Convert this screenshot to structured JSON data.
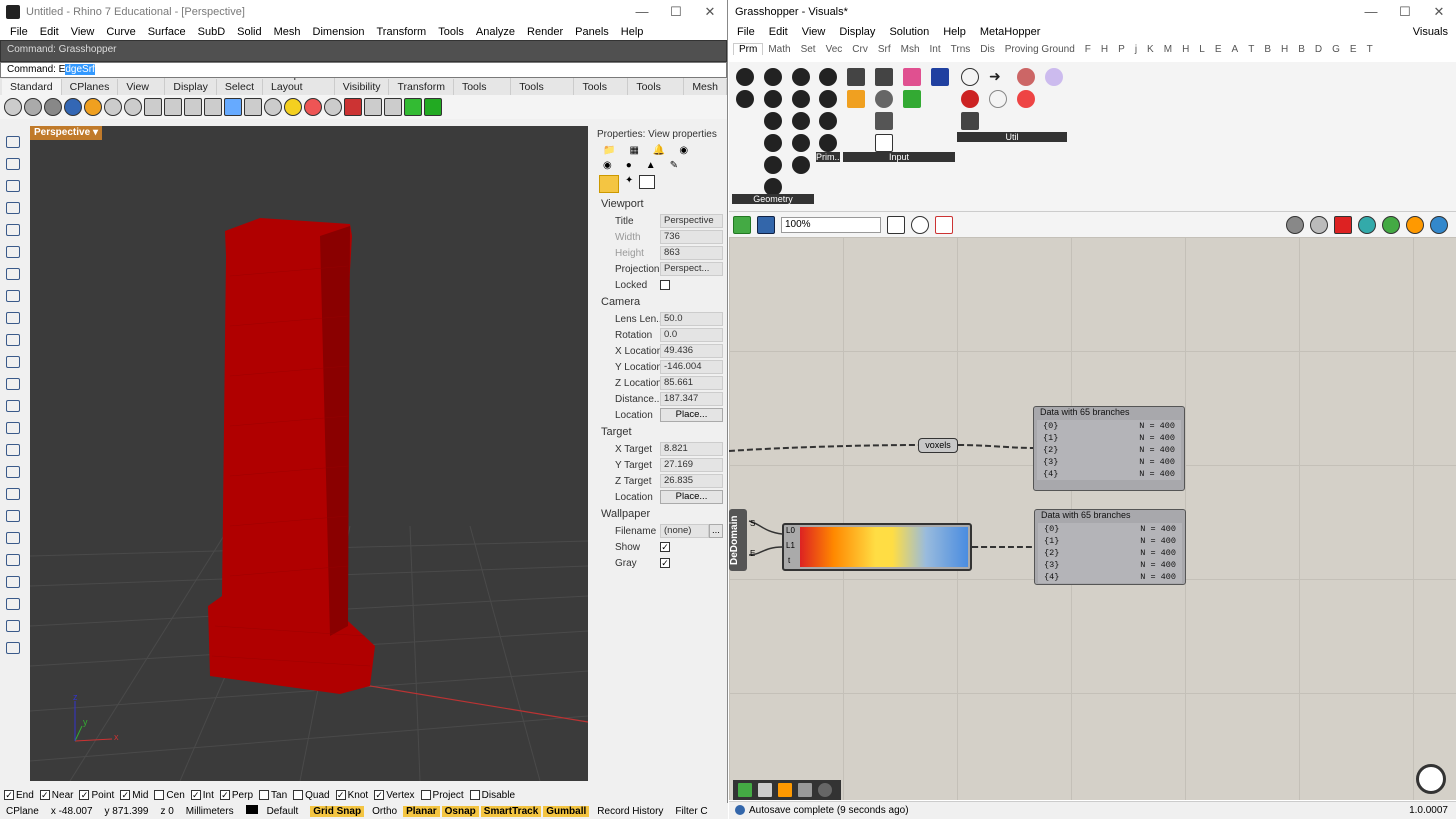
{
  "rhino": {
    "title": "Untitled - Rhino 7 Educational - [Perspective]",
    "menu": [
      "File",
      "Edit",
      "View",
      "Curve",
      "Surface",
      "SubD",
      "Solid",
      "Mesh",
      "Dimension",
      "Transform",
      "Tools",
      "Analyze",
      "Render",
      "Panels",
      "Help"
    ],
    "command_history": "Command: Grasshopper",
    "command_prefix": "Command: E",
    "command_selected": "dgeSrf",
    "toolbar_tabs": [
      "Standard",
      "CPlanes",
      "Set View",
      "Display",
      "Select",
      "Viewport Layout",
      "Visibility",
      "Transform",
      "Curve Tools",
      "Surface Tools",
      "Solid Tools",
      "SubD Tools",
      "Mesh"
    ],
    "viewport_label": "Perspective",
    "axis_x": "x",
    "axis_y": "y",
    "axis_z": "z",
    "properties_title": "Properties: View properties",
    "sections": {
      "viewport": "Viewport",
      "camera": "Camera",
      "target": "Target",
      "wallpaper": "Wallpaper"
    },
    "vp": {
      "title_l": "Title",
      "title_v": "Perspective",
      "width_l": "Width",
      "width_v": "736",
      "height_l": "Height",
      "height_v": "863",
      "proj_l": "Projection",
      "proj_v": "Perspect...",
      "locked_l": "Locked"
    },
    "cam": {
      "lens_l": "Lens Len...",
      "lens_v": "50.0",
      "rot_l": "Rotation",
      "rot_v": "0.0",
      "xl_l": "X Location",
      "xl_v": "49.436",
      "yl_l": "Y Location",
      "yl_v": "-146.004",
      "zl_l": "Z Location",
      "zl_v": "85.661",
      "dist_l": "Distance...",
      "dist_v": "187.347",
      "loc_l": "Location",
      "loc_btn": "Place..."
    },
    "tgt": {
      "xt_l": "X Target",
      "xt_v": "8.821",
      "yt_l": "Y Target",
      "yt_v": "27.169",
      "zt_l": "Z Target",
      "zt_v": "26.835",
      "loc_l": "Location",
      "loc_btn": "Place..."
    },
    "wp": {
      "file_l": "Filename",
      "file_v": "(none)",
      "file_btn": "...",
      "show_l": "Show",
      "gray_l": "Gray"
    },
    "osnaps": [
      {
        "label": "End",
        "checked": true
      },
      {
        "label": "Near",
        "checked": true
      },
      {
        "label": "Point",
        "checked": true
      },
      {
        "label": "Mid",
        "checked": true
      },
      {
        "label": "Cen",
        "checked": false
      },
      {
        "label": "Int",
        "checked": true
      },
      {
        "label": "Perp",
        "checked": true
      },
      {
        "label": "Tan",
        "checked": false
      },
      {
        "label": "Quad",
        "checked": false
      },
      {
        "label": "Knot",
        "checked": true
      },
      {
        "label": "Vertex",
        "checked": true
      },
      {
        "label": "Project",
        "checked": false
      },
      {
        "label": "Disable",
        "checked": false
      }
    ],
    "status": {
      "cplane": "CPlane",
      "x": "x -48.007",
      "y": "y 871.399",
      "z": "z 0",
      "units": "Millimeters",
      "layer": "Default",
      "grid_snap": "Grid Snap",
      "ortho": "Ortho",
      "planar": "Planar",
      "osnap": "Osnap",
      "smarttrack": "SmartTrack",
      "gumball": "Gumball",
      "record": "Record History",
      "filter": "Filter C"
    },
    "model_color": "#b00000"
  },
  "gh": {
    "title": "Grasshopper - Visuals*",
    "menu": [
      "File",
      "Edit",
      "View",
      "Display",
      "Solution",
      "Help",
      "MetaHopper"
    ],
    "menu_right": "Visuals",
    "tabs": [
      "Prm",
      "Math",
      "Set",
      "Vec",
      "Crv",
      "Srf",
      "Msh",
      "Int",
      "Trns",
      "Dis",
      "Proving Ground",
      "F",
      "H",
      "P",
      "j",
      "K",
      "M",
      "H",
      "L",
      "E",
      "A",
      "T",
      "B",
      "H",
      "B",
      "D",
      "G",
      "E",
      "T"
    ],
    "groups": {
      "geometry": "Geometry",
      "prim": "Prim...",
      "input": "Input",
      "util": "Util"
    },
    "zoom": "100%",
    "voxels": "voxels",
    "dedomain": "DeDomain",
    "dedomain_s": "S",
    "dedomain_e": "E",
    "grad_l0": "L0",
    "grad_l1": "L1",
    "grad_t": "t",
    "panel1": {
      "title": "Data with 65 branches",
      "rows": [
        {
          "k": "{0}",
          "v": "N = 400"
        },
        {
          "k": "{1}",
          "v": "N = 400"
        },
        {
          "k": "{2}",
          "v": "N = 400"
        },
        {
          "k": "{3}",
          "v": "N = 400"
        },
        {
          "k": "{4}",
          "v": "N = 400"
        }
      ]
    },
    "panel2": {
      "title": "Data with 65 branches",
      "rows": [
        {
          "k": "{0}",
          "v": "N = 400"
        },
        {
          "k": "{1}",
          "v": "N = 400"
        },
        {
          "k": "{2}",
          "v": "N = 400"
        },
        {
          "k": "{3}",
          "v": "N = 400"
        },
        {
          "k": "{4}",
          "v": "N = 400"
        }
      ]
    },
    "status": "Autosave complete (9 seconds ago)",
    "version": "1.0.0007"
  }
}
